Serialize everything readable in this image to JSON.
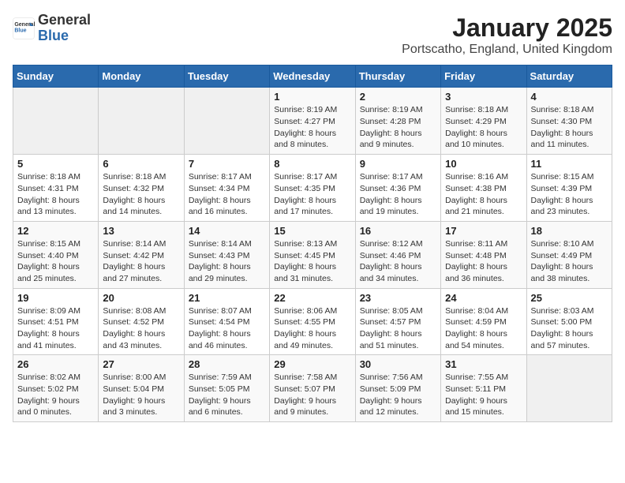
{
  "logo": {
    "general": "General",
    "blue": "Blue"
  },
  "header": {
    "title": "January 2025",
    "location": "Portscatho, England, United Kingdom"
  },
  "weekdays": [
    "Sunday",
    "Monday",
    "Tuesday",
    "Wednesday",
    "Thursday",
    "Friday",
    "Saturday"
  ],
  "weeks": [
    [
      {
        "day": "",
        "empty": true
      },
      {
        "day": "",
        "empty": true
      },
      {
        "day": "",
        "empty": true
      },
      {
        "day": "1",
        "sunrise": "8:19 AM",
        "sunset": "4:27 PM",
        "daylight": "8 hours and 8 minutes."
      },
      {
        "day": "2",
        "sunrise": "8:19 AM",
        "sunset": "4:28 PM",
        "daylight": "8 hours and 9 minutes."
      },
      {
        "day": "3",
        "sunrise": "8:18 AM",
        "sunset": "4:29 PM",
        "daylight": "8 hours and 10 minutes."
      },
      {
        "day": "4",
        "sunrise": "8:18 AM",
        "sunset": "4:30 PM",
        "daylight": "8 hours and 11 minutes."
      }
    ],
    [
      {
        "day": "5",
        "sunrise": "8:18 AM",
        "sunset": "4:31 PM",
        "daylight": "8 hours and 13 minutes."
      },
      {
        "day": "6",
        "sunrise": "8:18 AM",
        "sunset": "4:32 PM",
        "daylight": "8 hours and 14 minutes."
      },
      {
        "day": "7",
        "sunrise": "8:17 AM",
        "sunset": "4:34 PM",
        "daylight": "8 hours and 16 minutes."
      },
      {
        "day": "8",
        "sunrise": "8:17 AM",
        "sunset": "4:35 PM",
        "daylight": "8 hours and 17 minutes."
      },
      {
        "day": "9",
        "sunrise": "8:17 AM",
        "sunset": "4:36 PM",
        "daylight": "8 hours and 19 minutes."
      },
      {
        "day": "10",
        "sunrise": "8:16 AM",
        "sunset": "4:38 PM",
        "daylight": "8 hours and 21 minutes."
      },
      {
        "day": "11",
        "sunrise": "8:15 AM",
        "sunset": "4:39 PM",
        "daylight": "8 hours and 23 minutes."
      }
    ],
    [
      {
        "day": "12",
        "sunrise": "8:15 AM",
        "sunset": "4:40 PM",
        "daylight": "8 hours and 25 minutes."
      },
      {
        "day": "13",
        "sunrise": "8:14 AM",
        "sunset": "4:42 PM",
        "daylight": "8 hours and 27 minutes."
      },
      {
        "day": "14",
        "sunrise": "8:14 AM",
        "sunset": "4:43 PM",
        "daylight": "8 hours and 29 minutes."
      },
      {
        "day": "15",
        "sunrise": "8:13 AM",
        "sunset": "4:45 PM",
        "daylight": "8 hours and 31 minutes."
      },
      {
        "day": "16",
        "sunrise": "8:12 AM",
        "sunset": "4:46 PM",
        "daylight": "8 hours and 34 minutes."
      },
      {
        "day": "17",
        "sunrise": "8:11 AM",
        "sunset": "4:48 PM",
        "daylight": "8 hours and 36 minutes."
      },
      {
        "day": "18",
        "sunrise": "8:10 AM",
        "sunset": "4:49 PM",
        "daylight": "8 hours and 38 minutes."
      }
    ],
    [
      {
        "day": "19",
        "sunrise": "8:09 AM",
        "sunset": "4:51 PM",
        "daylight": "8 hours and 41 minutes."
      },
      {
        "day": "20",
        "sunrise": "8:08 AM",
        "sunset": "4:52 PM",
        "daylight": "8 hours and 43 minutes."
      },
      {
        "day": "21",
        "sunrise": "8:07 AM",
        "sunset": "4:54 PM",
        "daylight": "8 hours and 46 minutes."
      },
      {
        "day": "22",
        "sunrise": "8:06 AM",
        "sunset": "4:55 PM",
        "daylight": "8 hours and 49 minutes."
      },
      {
        "day": "23",
        "sunrise": "8:05 AM",
        "sunset": "4:57 PM",
        "daylight": "8 hours and 51 minutes."
      },
      {
        "day": "24",
        "sunrise": "8:04 AM",
        "sunset": "4:59 PM",
        "daylight": "8 hours and 54 minutes."
      },
      {
        "day": "25",
        "sunrise": "8:03 AM",
        "sunset": "5:00 PM",
        "daylight": "8 hours and 57 minutes."
      }
    ],
    [
      {
        "day": "26",
        "sunrise": "8:02 AM",
        "sunset": "5:02 PM",
        "daylight": "9 hours and 0 minutes."
      },
      {
        "day": "27",
        "sunrise": "8:00 AM",
        "sunset": "5:04 PM",
        "daylight": "9 hours and 3 minutes."
      },
      {
        "day": "28",
        "sunrise": "7:59 AM",
        "sunset": "5:05 PM",
        "daylight": "9 hours and 6 minutes."
      },
      {
        "day": "29",
        "sunrise": "7:58 AM",
        "sunset": "5:07 PM",
        "daylight": "9 hours and 9 minutes."
      },
      {
        "day": "30",
        "sunrise": "7:56 AM",
        "sunset": "5:09 PM",
        "daylight": "9 hours and 12 minutes."
      },
      {
        "day": "31",
        "sunrise": "7:55 AM",
        "sunset": "5:11 PM",
        "daylight": "9 hours and 15 minutes."
      },
      {
        "day": "",
        "empty": true
      }
    ]
  ],
  "labels": {
    "sunrise": "Sunrise:",
    "sunset": "Sunset:",
    "daylight": "Daylight:"
  }
}
